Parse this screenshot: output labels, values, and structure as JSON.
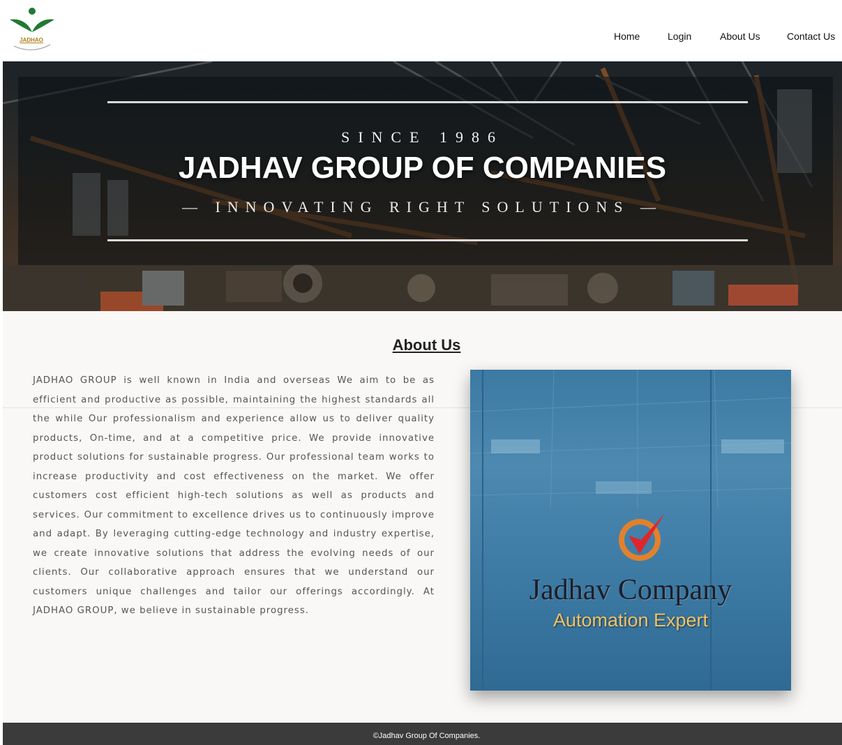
{
  "header": {
    "logo_text": "JADHAO",
    "nav": [
      "Home",
      "Login",
      "About Us",
      "Contact Us"
    ]
  },
  "hero": {
    "since": "SINCE 1986",
    "title": "JADHAV GROUP OF COMPANIES",
    "tagline": "— INNOVATING RIGHT SOLUTIONS —"
  },
  "about": {
    "heading": "About Us",
    "body": "JADHAO GROUP is well known in India and overseas We aim to be as efficient and productive as possible, maintaining the highest standards all the while Our professionalism and experience allow us to deliver quality products, On-time, and at a competitive price. We provide innovative product solutions for sustainable progress. Our professional team works to increase productivity and cost effectiveness on the market. We offer customers cost efficient high-tech solutions as well as products and services. Our commitment to excellence drives us to continuously improve and adapt. By leveraging cutting-edge technology and industry expertise, we create innovative solutions that address the evolving needs of our clients. Our collaborative approach ensures that we understand our customers unique challenges and tailor our offerings accordingly. At JADHAO GROUP, we believe in sustainable progress."
  },
  "photo": {
    "company_name": "Jadhav Company",
    "company_sub": "Automation Expert"
  },
  "footer": {
    "copyright": "©Jadhav Group Of Companies."
  },
  "colors": {
    "footer_bg": "#3b3b3b",
    "logo_green": "#1f7a32",
    "logo_gold": "#b07d1c",
    "check_red": "#e0262a",
    "ring_orange": "#e2812d"
  }
}
